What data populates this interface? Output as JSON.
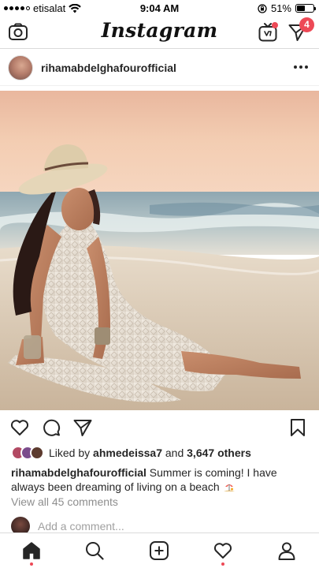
{
  "status_bar": {
    "carrier": "etisalat",
    "time": "9:04 AM",
    "battery_percent": "51%",
    "battery_level": 0.51
  },
  "nav": {
    "logo": "Instagram",
    "direct_badge_count": "4",
    "icons": [
      "camera-icon",
      "igtv-icon",
      "direct-message-icon"
    ]
  },
  "post": {
    "username": "rihamabdelghafourofficial",
    "likes": {
      "prefix": "Liked by ",
      "user": "ahmedeissa7",
      "middle": " and ",
      "count": "3,647 others"
    },
    "caption": {
      "username": "rihamabdelghafourofficial",
      "text": " Summer is coming! I have always been dreaming of living on a beach "
    },
    "view_comments": "View all 45 comments",
    "comment_placeholder": "Add a comment..."
  },
  "tab_bar": {
    "tabs": [
      "home-icon",
      "search-icon",
      "new-post-icon",
      "activity-icon",
      "profile-icon"
    ]
  },
  "colors": {
    "accent_red": "#ed4956",
    "text": "#262626",
    "muted": "#8e8e8e"
  }
}
